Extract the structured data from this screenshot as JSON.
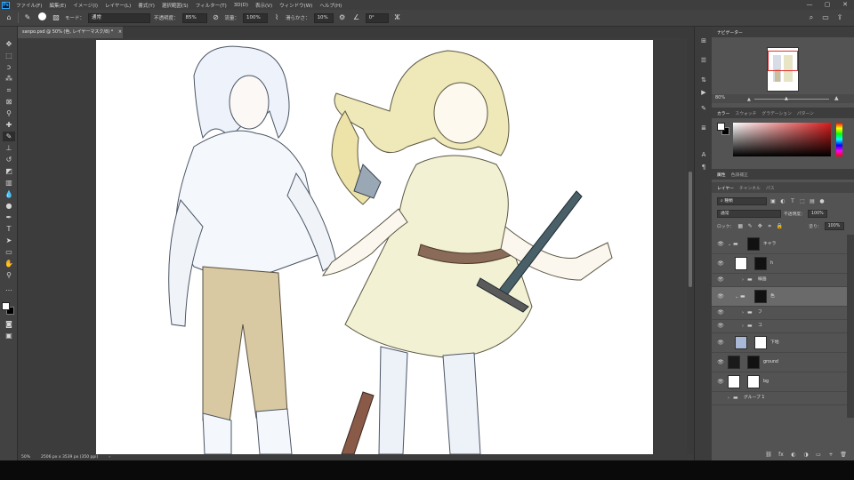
{
  "menu": {
    "items": [
      "ファイル(F)",
      "編集(E)",
      "イメージ(I)",
      "レイヤー(L)",
      "書式(Y)",
      "選択範囲(S)",
      "フィルター(T)",
      "3D(D)",
      "表示(V)",
      "ウィンドウ(W)",
      "ヘルプ(H)"
    ],
    "app_badge": "Ps",
    "min_icon": "—",
    "max_icon": "▢",
    "close_icon": "✕"
  },
  "options": {
    "home_icon": "⌂",
    "brush_icon": "✎",
    "brush_size": "",
    "brush_panel_icon": "▨",
    "mode_label": "モード：",
    "mode_value": "通常",
    "opacity_label": "不透明度：",
    "opacity_value": "85%",
    "flow_label": "流量：",
    "flow_value": "100%",
    "smooth_label": "滑らかさ：",
    "smooth_value": "10%",
    "angle_value": "0°",
    "search_icon": "⌕",
    "workspace_icon": "▭",
    "share_icon": "⇪"
  },
  "document": {
    "tab_title": "sanpo.psd @ 50% (色, レイヤーマスク/8) *",
    "close_icon": "×"
  },
  "status": {
    "zoom": "50%",
    "size": "2506 px x 3539 px (350 ppi)",
    "arrow": "›"
  },
  "navigator": {
    "tabs": [
      "ナビゲーター"
    ],
    "zoom": "80%"
  },
  "color": {
    "tabs": [
      "カラー",
      "スウォッチ",
      "グラデーション",
      "パターン"
    ],
    "fg": "#ffffff",
    "bg": "#000000"
  },
  "layers": {
    "tabs": [
      "属性",
      "色調補正"
    ],
    "subtabs": [
      "レイヤー",
      "チャンネル",
      "パス"
    ],
    "filter": "種類",
    "blend": "通常",
    "opacity_label": "不透明度：",
    "opacity": "100%",
    "lock_label": "ロック：",
    "fill_label": "塗り：",
    "fill": "100%",
    "items": [
      {
        "name": "キャラ",
        "type": "group-mask"
      },
      {
        "name": "h",
        "type": "pixel-mask"
      },
      {
        "name": "線画",
        "type": "group"
      },
      {
        "name": "色",
        "type": "group-mask"
      },
      {
        "name": "フ",
        "type": "group"
      },
      {
        "name": "コ",
        "type": "group"
      },
      {
        "name": "下地",
        "type": "pixel-mask"
      },
      {
        "name": "ground",
        "type": "pixel-mask"
      },
      {
        "name": "bg",
        "type": "pixel-mask"
      },
      {
        "name": "グループ 1",
        "type": "group"
      }
    ],
    "bottom_icons": [
      "⛓",
      "fx",
      "◐",
      "◑",
      "▭",
      "+",
      "🗑"
    ]
  },
  "colors": {
    "accent": "#31a8ff",
    "canvas": "#ffffff",
    "panel": "#535353",
    "selected_layer": "#6a6a6a"
  }
}
